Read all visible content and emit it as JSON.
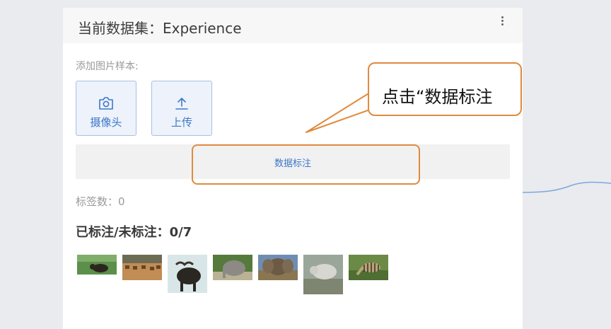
{
  "panel": {
    "title": "当前数据集：Experience",
    "add_samples_label": "添加图片样本:",
    "camera_button": "摄像头",
    "upload_button": "上传",
    "annotate_button": "数据标注",
    "tag_count": "标签数：0",
    "status": "已标注/未标注：0/7"
  },
  "thumbnails": [
    {
      "name": "buffalo-field"
    },
    {
      "name": "antelope-herd"
    },
    {
      "name": "cape-buffalo"
    },
    {
      "name": "elephant-grass"
    },
    {
      "name": "elephant-front"
    },
    {
      "name": "rhino-bush"
    },
    {
      "name": "zebra-grazing"
    }
  ],
  "callout": {
    "text": "点击“数据标注"
  },
  "colors": {
    "accent_blue": "#3d78c8",
    "highlight_orange": "#e08a3e"
  },
  "icons": [
    "more-vertical-icon",
    "camera-icon",
    "upload-icon"
  ]
}
